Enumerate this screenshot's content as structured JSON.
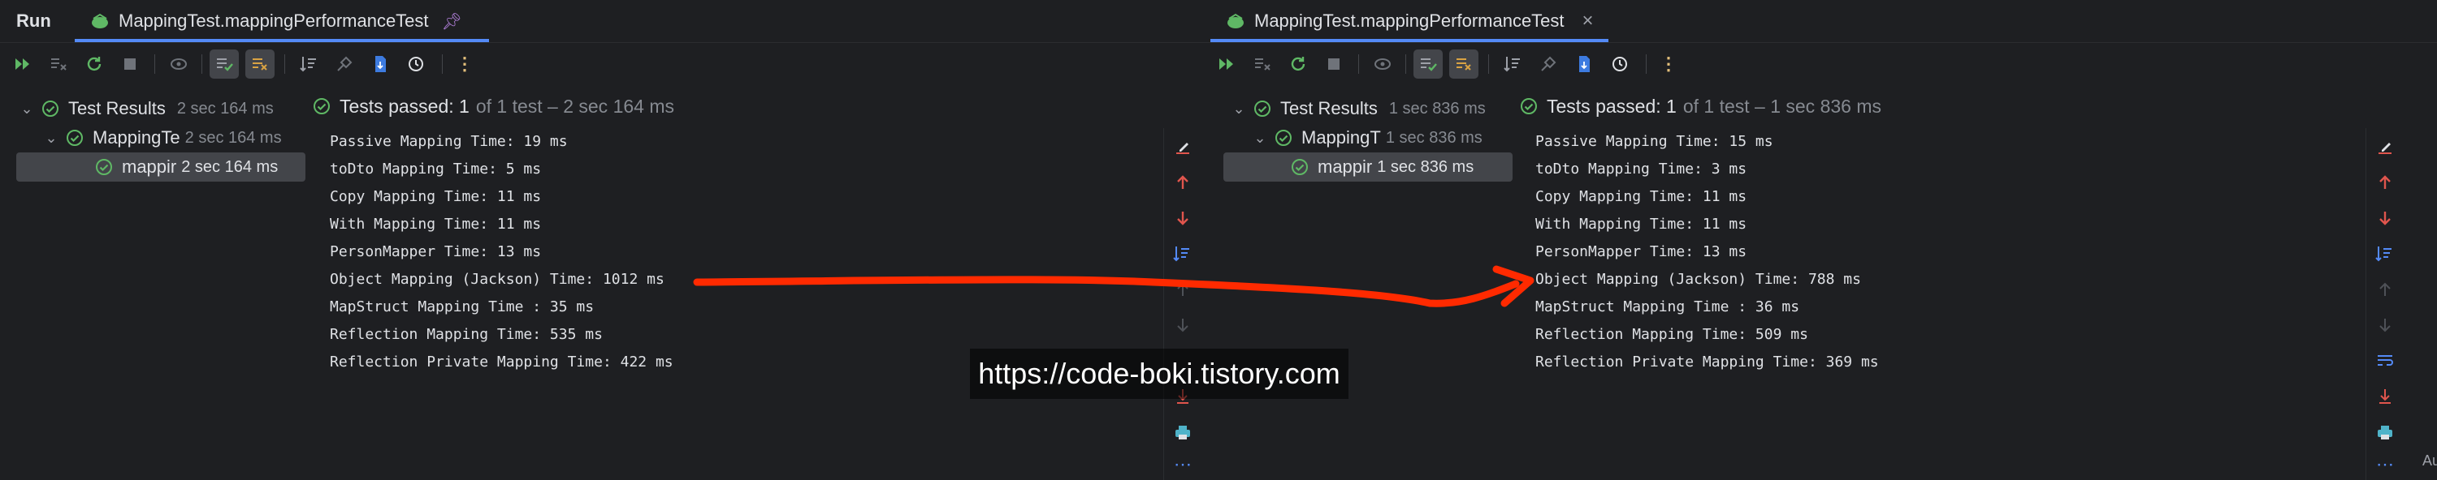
{
  "left": {
    "run_label": "Run",
    "tab_title": "MappingTest.mappingPerformanceTest",
    "tree": [
      {
        "label": "Test Results",
        "duration": "2 sec 164 ms"
      },
      {
        "label": "MappingTe",
        "duration": "2 sec 164 ms"
      },
      {
        "label": "mappir",
        "duration": "2 sec 164 ms"
      }
    ],
    "status": {
      "passed": "Tests passed: 1",
      "rest": "of 1 test – 2 sec 164 ms"
    },
    "lines": [
      "Passive Mapping Time: 19 ms",
      "toDto Mapping Time: 5 ms",
      "Copy Mapping Time: 11 ms",
      "With Mapping Time: 11 ms",
      "PersonMapper Time: 13 ms",
      "Object Mapping (Jackson) Time: 1012 ms",
      "MapStruct Mapping Time : 35 ms",
      "Reflection Mapping Time: 535 ms",
      "Reflection Private Mapping Time: 422 ms"
    ]
  },
  "right": {
    "tab_title": "MappingTest.mappingPerformanceTest",
    "tree": [
      {
        "label": "Test Results",
        "duration": "1 sec 836 ms"
      },
      {
        "label": "MappingT",
        "duration": "1 sec 836 ms"
      },
      {
        "label": "mappir",
        "duration": "1 sec 836 ms"
      }
    ],
    "status": {
      "passed": "Tests passed: 1",
      "rest": "of 1 test – 1 sec 836 ms"
    },
    "lines": [
      "Passive Mapping Time: 15 ms",
      "toDto Mapping Time: 3 ms",
      "Copy Mapping Time: 11 ms",
      "With Mapping Time: 11 ms",
      "PersonMapper Time: 13 ms",
      "Object Mapping (Jackson) Time: 788 ms",
      "MapStruct Mapping Time : 36 ms",
      "Reflection Mapping Time: 509 ms",
      "Reflection Private Mapping Time: 369 ms"
    ]
  },
  "watermark": "https://code-boki.tistory.com",
  "edge_text": "Au",
  "colors": {
    "pass_green": "#5fb865",
    "rerun_green": "#5fb865",
    "accent_blue": "#548af7",
    "arrow_red": "#ff2a00",
    "error_red": "#e0554d"
  }
}
